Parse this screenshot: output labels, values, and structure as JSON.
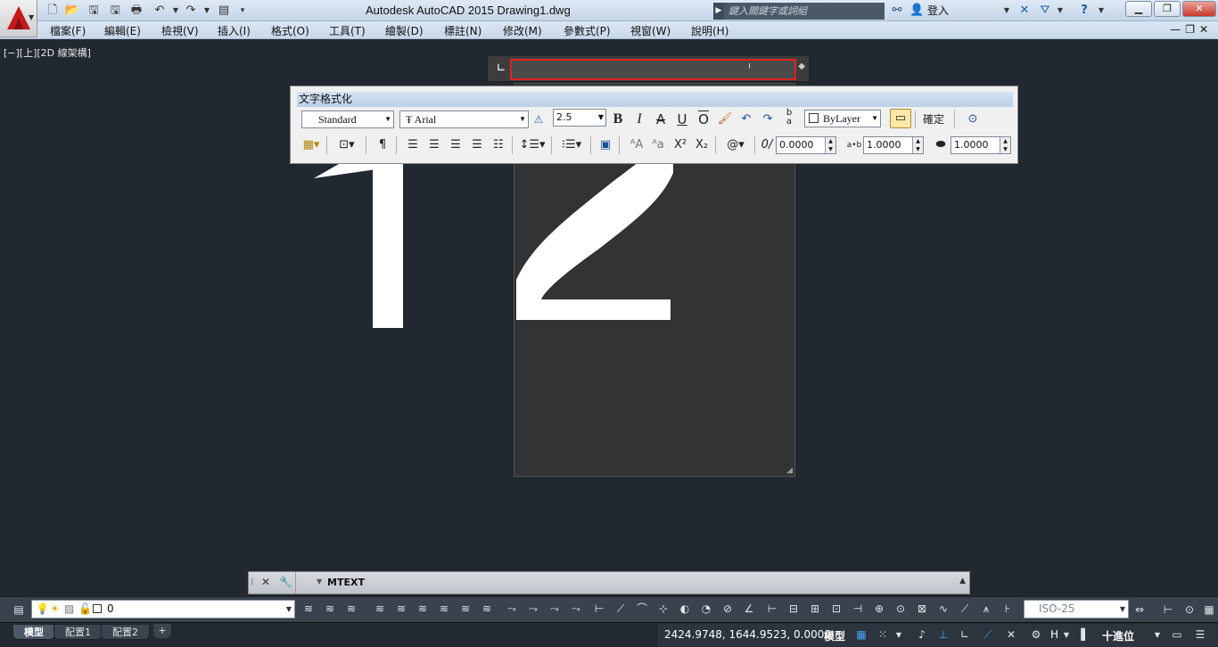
{
  "app": {
    "title": "Autodesk AutoCAD 2015    Drawing1.dwg"
  },
  "search": {
    "placeholder": "鍵入關鍵字或詞組"
  },
  "user": {
    "login_label": "登入"
  },
  "menu": [
    "檔案(F)",
    "編輯(E)",
    "檢視(V)",
    "插入(I)",
    "格式(O)",
    "工具(T)",
    "繪製(D)",
    "標註(N)",
    "修改(M)",
    "參數式(P)",
    "視窗(W)",
    "說明(H)"
  ],
  "viewport": {
    "label": "[−][上][2D 線架構]"
  },
  "text_formatting": {
    "title": "文字格式化",
    "style": "Standard",
    "font": "Arial",
    "height": "2.5",
    "color": "ByLayer",
    "ok_label": "確定",
    "oblique": "0.0000",
    "tracking": "1.0000",
    "width_factor": "1.0000",
    "tracking_label": "a•b"
  },
  "command": {
    "text": "MTEXT"
  },
  "layer": {
    "name": "0"
  },
  "dimstyle": {
    "name": "ISO-25"
  },
  "layout_tabs": [
    "模型",
    "配置1",
    "配置2"
  ],
  "status": {
    "coords": "2424.9748, 1644.9523, 0.0000",
    "model_label": "模型",
    "units_label": "十進位",
    "annotation_scale": "H"
  },
  "colors": {
    "accent": "#e02020",
    "canvas": "#212830",
    "toolbar_title": "#c6d7ec"
  }
}
